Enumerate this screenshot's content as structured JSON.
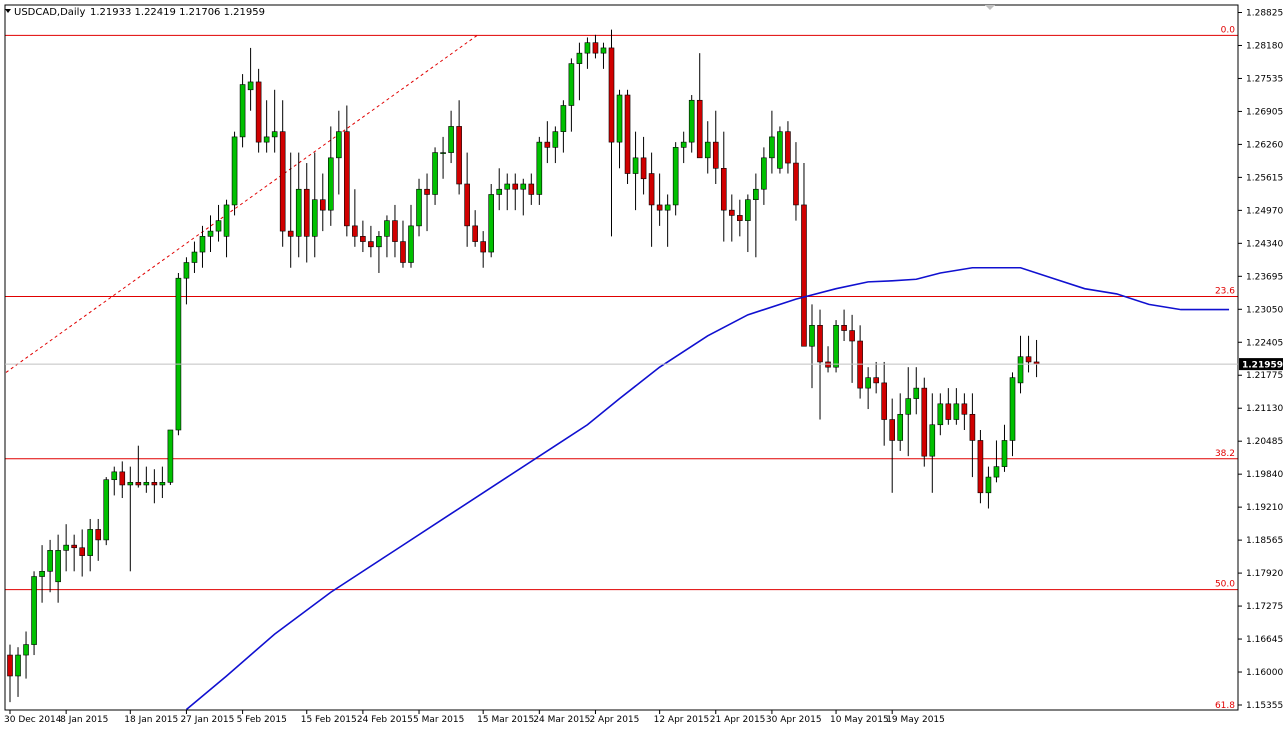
{
  "header": {
    "symbol": "USDCAD,Daily",
    "ohlc": "1.21933 1.22419 1.21706 1.21959"
  },
  "colors": {
    "bull": "#00c000",
    "bear": "#d00000",
    "ma": "#1010d0",
    "fib": "#e00000",
    "axis": "#000000"
  },
  "icons": {
    "menu": "triangle-down-icon"
  },
  "chart_data": {
    "type": "candlestick",
    "ylim": [
      1.1535,
      1.2882
    ],
    "current_price": "1.21959",
    "y_ticks": [
      "1.28825",
      "1.28180",
      "1.27535",
      "1.26905",
      "1.26260",
      "1.25615",
      "1.24970",
      "1.24340",
      "1.23695",
      "1.23050",
      "1.22405",
      "1.21775",
      "1.21130",
      "1.20485",
      "1.19840",
      "1.19210",
      "1.18565",
      "1.17920",
      "1.17275",
      "1.16645",
      "1.16000",
      "1.15355"
    ],
    "x_ticks": [
      {
        "label": "30 Dec 2014",
        "i": 0
      },
      {
        "label": "8 Jan 2015",
        "i": 7
      },
      {
        "label": "18 Jan 2015",
        "i": 15
      },
      {
        "label": "27 Jan 2015",
        "i": 22
      },
      {
        "label": "5 Feb 2015",
        "i": 29
      },
      {
        "label": "15 Feb 2015",
        "i": 37
      },
      {
        "label": "24 Feb 2015",
        "i": 44
      },
      {
        "label": "5 Mar 2015",
        "i": 51
      },
      {
        "label": "15 Mar 2015",
        "i": 59
      },
      {
        "label": "24 Mar 2015",
        "i": 66
      },
      {
        "label": "2 Apr 2015",
        "i": 73
      },
      {
        "label": "12 Apr 2015",
        "i": 81
      },
      {
        "label": "21 Apr 2015",
        "i": 88
      },
      {
        "label": "30 Apr 2015",
        "i": 95
      },
      {
        "label": "10 May 2015",
        "i": 103
      },
      {
        "label": "19 May 2015",
        "i": 110
      }
    ],
    "fib_levels": [
      {
        "label": "0.0",
        "value": 1.2824
      },
      {
        "label": "23.6",
        "value": 1.2325
      },
      {
        "label": "38.2",
        "value": 1.2015
      },
      {
        "label": "50.0",
        "value": 1.1765
      },
      {
        "label": "61.8",
        "value": 1.1512
      }
    ],
    "fib_trend": {
      "from": {
        "i": 0,
        "value": 1.218
      },
      "to": {
        "i": 59,
        "value": 1.2824
      }
    },
    "candles": [
      [
        1.164,
        1.166,
        1.155,
        1.16
      ],
      [
        1.16,
        1.1655,
        1.156,
        1.164
      ],
      [
        1.164,
        1.1685,
        1.1595,
        1.166
      ],
      [
        1.166,
        1.18,
        1.164,
        1.179
      ],
      [
        1.179,
        1.185,
        1.174,
        1.18
      ],
      [
        1.18,
        1.186,
        1.176,
        1.184
      ],
      [
        1.178,
        1.187,
        1.174,
        1.184
      ],
      [
        1.184,
        1.189,
        1.18,
        1.185
      ],
      [
        1.185,
        1.187,
        1.18,
        1.1845
      ],
      [
        1.1845,
        1.188,
        1.179,
        1.183
      ],
      [
        1.183,
        1.19,
        1.18,
        1.188
      ],
      [
        1.188,
        1.19,
        1.182,
        1.186
      ],
      [
        1.186,
        1.198,
        1.185,
        1.1975
      ],
      [
        1.1975,
        1.2,
        1.1945,
        1.199
      ],
      [
        1.199,
        1.201,
        1.194,
        1.1965
      ],
      [
        1.1965,
        1.2,
        1.18,
        1.197
      ],
      [
        1.197,
        1.204,
        1.196,
        1.1965
      ],
      [
        1.1965,
        1.2,
        1.195,
        1.197
      ],
      [
        1.197,
        1.1995,
        1.193,
        1.1965
      ],
      [
        1.1965,
        1.2,
        1.194,
        1.197
      ],
      [
        1.197,
        1.207,
        1.1965,
        1.207
      ],
      [
        1.207,
        1.237,
        1.206,
        1.236
      ],
      [
        1.236,
        1.24,
        1.231,
        1.239
      ],
      [
        1.239,
        1.243,
        1.237,
        1.241
      ],
      [
        1.241,
        1.246,
        1.238,
        1.244
      ],
      [
        1.244,
        1.248,
        1.241,
        1.245
      ],
      [
        1.245,
        1.25,
        1.243,
        1.247
      ],
      [
        1.244,
        1.251,
        1.24,
        1.25
      ],
      [
        1.25,
        1.264,
        1.248,
        1.263
      ],
      [
        1.263,
        1.275,
        1.261,
        1.273
      ],
      [
        1.272,
        1.28,
        1.268,
        1.2735
      ],
      [
        1.2735,
        1.276,
        1.26,
        1.262
      ],
      [
        1.262,
        1.27,
        1.26,
        1.263
      ],
      [
        1.263,
        1.272,
        1.26,
        1.264
      ],
      [
        1.264,
        1.27,
        1.242,
        1.245
      ],
      [
        1.245,
        1.26,
        1.238,
        1.244
      ],
      [
        1.244,
        1.26,
        1.24,
        1.253
      ],
      [
        1.253,
        1.258,
        1.239,
        1.244
      ],
      [
        1.244,
        1.26,
        1.24,
        1.251
      ],
      [
        1.251,
        1.256,
        1.245,
        1.249
      ],
      [
        1.249,
        1.265,
        1.246,
        1.259
      ],
      [
        1.259,
        1.268,
        1.252,
        1.264
      ],
      [
        1.264,
        1.269,
        1.244,
        1.246
      ],
      [
        1.246,
        1.253,
        1.242,
        1.244
      ],
      [
        1.244,
        1.247,
        1.241,
        1.243
      ],
      [
        1.243,
        1.246,
        1.24,
        1.242
      ],
      [
        1.242,
        1.245,
        1.237,
        1.244
      ],
      [
        1.244,
        1.248,
        1.24,
        1.247
      ],
      [
        1.247,
        1.25,
        1.24,
        1.243
      ],
      [
        1.243,
        1.247,
        1.238,
        1.239
      ],
      [
        1.239,
        1.25,
        1.238,
        1.246
      ],
      [
        1.246,
        1.255,
        1.244,
        1.253
      ],
      [
        1.253,
        1.256,
        1.245,
        1.252
      ],
      [
        1.252,
        1.261,
        1.25,
        1.26
      ],
      [
        1.26,
        1.263,
        1.255,
        1.26
      ],
      [
        1.26,
        1.268,
        1.258,
        1.265
      ],
      [
        1.265,
        1.27,
        1.252,
        1.254
      ],
      [
        1.254,
        1.26,
        1.242,
        1.246
      ],
      [
        1.246,
        1.249,
        1.242,
        1.243
      ],
      [
        1.243,
        1.245,
        1.238,
        1.241
      ],
      [
        1.241,
        1.254,
        1.24,
        1.252
      ],
      [
        1.252,
        1.257,
        1.249,
        1.253
      ],
      [
        1.253,
        1.256,
        1.249,
        1.254
      ],
      [
        1.254,
        1.256,
        1.249,
        1.253
      ],
      [
        1.253,
        1.255,
        1.248,
        1.254
      ],
      [
        1.254,
        1.256,
        1.25,
        1.252
      ],
      [
        1.252,
        1.263,
        1.25,
        1.262
      ],
      [
        1.262,
        1.266,
        1.258,
        1.261
      ],
      [
        1.261,
        1.265,
        1.258,
        1.264
      ],
      [
        1.264,
        1.27,
        1.26,
        1.269
      ],
      [
        1.269,
        1.278,
        1.264,
        1.277
      ],
      [
        1.277,
        1.281,
        1.27,
        1.279
      ],
      [
        1.279,
        1.282,
        1.276,
        1.281
      ],
      [
        1.281,
        1.2825,
        1.278,
        1.279
      ],
      [
        1.279,
        1.281,
        1.276,
        1.28
      ],
      [
        1.28,
        1.2835,
        1.244,
        1.262
      ],
      [
        1.262,
        1.272,
        1.257,
        1.271
      ],
      [
        1.271,
        1.272,
        1.254,
        1.256
      ],
      [
        1.256,
        1.264,
        1.249,
        1.259
      ],
      [
        1.259,
        1.263,
        1.252,
        1.255
      ],
      [
        1.256,
        1.26,
        1.242,
        1.25
      ],
      [
        1.25,
        1.256,
        1.246,
        1.249
      ],
      [
        1.249,
        1.252,
        1.242,
        1.25
      ],
      [
        1.25,
        1.262,
        1.248,
        1.261
      ],
      [
        1.261,
        1.264,
        1.258,
        1.262
      ],
      [
        1.262,
        1.271,
        1.26,
        1.27
      ],
      [
        1.27,
        1.279,
        1.262,
        1.259
      ],
      [
        1.259,
        1.266,
        1.256,
        1.262
      ],
      [
        1.262,
        1.268,
        1.254,
        1.257
      ],
      [
        1.257,
        1.264,
        1.243,
        1.249
      ],
      [
        1.249,
        1.252,
        1.243,
        1.248
      ],
      [
        1.248,
        1.251,
        1.244,
        1.247
      ],
      [
        1.247,
        1.252,
        1.241,
        1.251
      ],
      [
        1.251,
        1.256,
        1.24,
        1.253
      ],
      [
        1.253,
        1.261,
        1.25,
        1.259
      ],
      [
        1.259,
        1.268,
        1.256,
        1.263
      ],
      [
        1.257,
        1.265,
        1.256,
        1.264
      ],
      [
        1.264,
        1.266,
        1.256,
        1.258
      ],
      [
        1.258,
        1.262,
        1.247,
        1.25
      ],
      [
        1.25,
        1.258,
        1.228,
        1.223
      ],
      [
        1.223,
        1.231,
        1.215,
        1.227
      ],
      [
        1.227,
        1.23,
        1.209,
        1.22
      ],
      [
        1.22,
        1.223,
        1.218,
        1.219
      ],
      [
        1.219,
        1.228,
        1.218,
        1.227
      ],
      [
        1.227,
        1.23,
        1.224,
        1.226
      ],
      [
        1.226,
        1.229,
        1.216,
        1.224
      ],
      [
        1.224,
        1.227,
        1.213,
        1.215
      ],
      [
        1.215,
        1.219,
        1.211,
        1.217
      ],
      [
        1.217,
        1.22,
        1.214,
        1.216
      ],
      [
        1.216,
        1.22,
        1.204,
        1.209
      ],
      [
        1.209,
        1.213,
        1.195,
        1.205
      ],
      [
        1.205,
        1.214,
        1.203,
        1.21
      ],
      [
        1.21,
        1.219,
        1.202,
        1.213
      ],
      [
        1.213,
        1.219,
        1.21,
        1.215
      ],
      [
        1.215,
        1.217,
        1.2,
        1.202
      ],
      [
        1.202,
        1.214,
        1.195,
        1.208
      ],
      [
        1.208,
        1.214,
        1.206,
        1.212
      ],
      [
        1.212,
        1.215,
        1.208,
        1.209
      ],
      [
        1.209,
        1.215,
        1.208,
        1.212
      ],
      [
        1.212,
        1.214,
        1.207,
        1.21
      ],
      [
        1.21,
        1.214,
        1.198,
        1.205
      ],
      [
        1.205,
        1.207,
        1.193,
        1.195
      ],
      [
        1.195,
        1.2,
        1.192,
        1.198
      ],
      [
        1.198,
        1.205,
        1.197,
        1.2
      ],
      [
        1.2,
        1.208,
        1.199,
        1.205
      ],
      [
        1.205,
        1.218,
        1.202,
        1.217
      ],
      [
        1.216,
        1.225,
        1.214,
        1.221
      ],
      [
        1.221,
        1.225,
        1.218,
        1.22
      ],
      [
        1.22,
        1.2242,
        1.2171,
        1.2196
      ]
    ],
    "series": [
      {
        "type": "line",
        "values": [
          [
            22,
            1.1536
          ],
          [
            27,
            1.16
          ],
          [
            33,
            1.168
          ],
          [
            40,
            1.176
          ],
          [
            48,
            1.184
          ],
          [
            55,
            1.191
          ],
          [
            62,
            1.198
          ],
          [
            68,
            1.204
          ],
          [
            72,
            1.208
          ],
          [
            76,
            1.213
          ],
          [
            81,
            1.219
          ],
          [
            87,
            1.225
          ],
          [
            92,
            1.229
          ],
          [
            98,
            1.232
          ],
          [
            103,
            1.234
          ],
          [
            107,
            1.2353
          ],
          [
            110,
            1.2355
          ],
          [
            113,
            1.2358
          ],
          [
            116,
            1.237
          ],
          [
            120,
            1.238
          ],
          [
            123,
            1.238
          ],
          [
            126,
            1.238
          ],
          [
            130,
            1.236
          ],
          [
            134,
            1.234
          ],
          [
            138,
            1.233
          ],
          [
            142,
            1.231
          ],
          [
            146,
            1.23
          ],
          [
            150,
            1.23
          ],
          [
            152,
            1.23
          ]
        ]
      }
    ]
  }
}
